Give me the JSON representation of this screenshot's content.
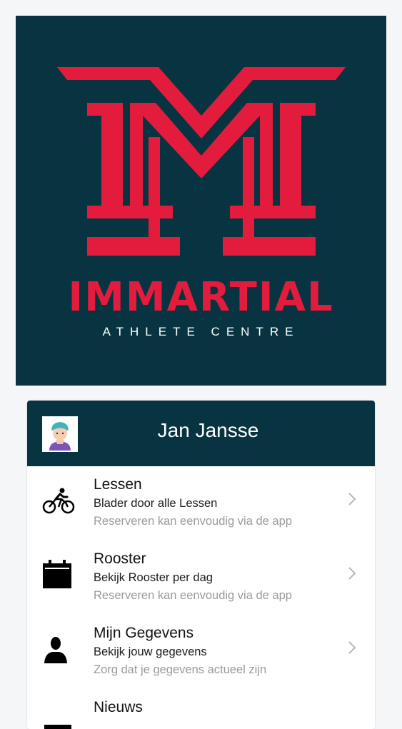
{
  "logo": {
    "brand": "IMMARTIAL",
    "tagline": "ATHLETE CENTRE",
    "background": "#073440",
    "accent": "#e31c3d"
  },
  "header": {
    "user_name": "Jan Jansse",
    "avatar_icon": "user-avatar-icon"
  },
  "menu": [
    {
      "title": "Lessen",
      "subtitle": "Blader door alle Lessen",
      "hint": "Reserveren kan eenvoudig via de app",
      "icon": "bicycle-icon"
    },
    {
      "title": "Rooster",
      "subtitle": "Bekijk Rooster per dag",
      "hint": "Reserveren kan eenvoudig via de app",
      "icon": "calendar-icon"
    },
    {
      "title": "Mijn Gegevens",
      "subtitle": "Bekijk jouw gegevens",
      "hint": "Zorg dat je gegevens actueel zijn",
      "icon": "person-icon"
    },
    {
      "title": "Nieuws",
      "icon": "news-icon"
    }
  ]
}
